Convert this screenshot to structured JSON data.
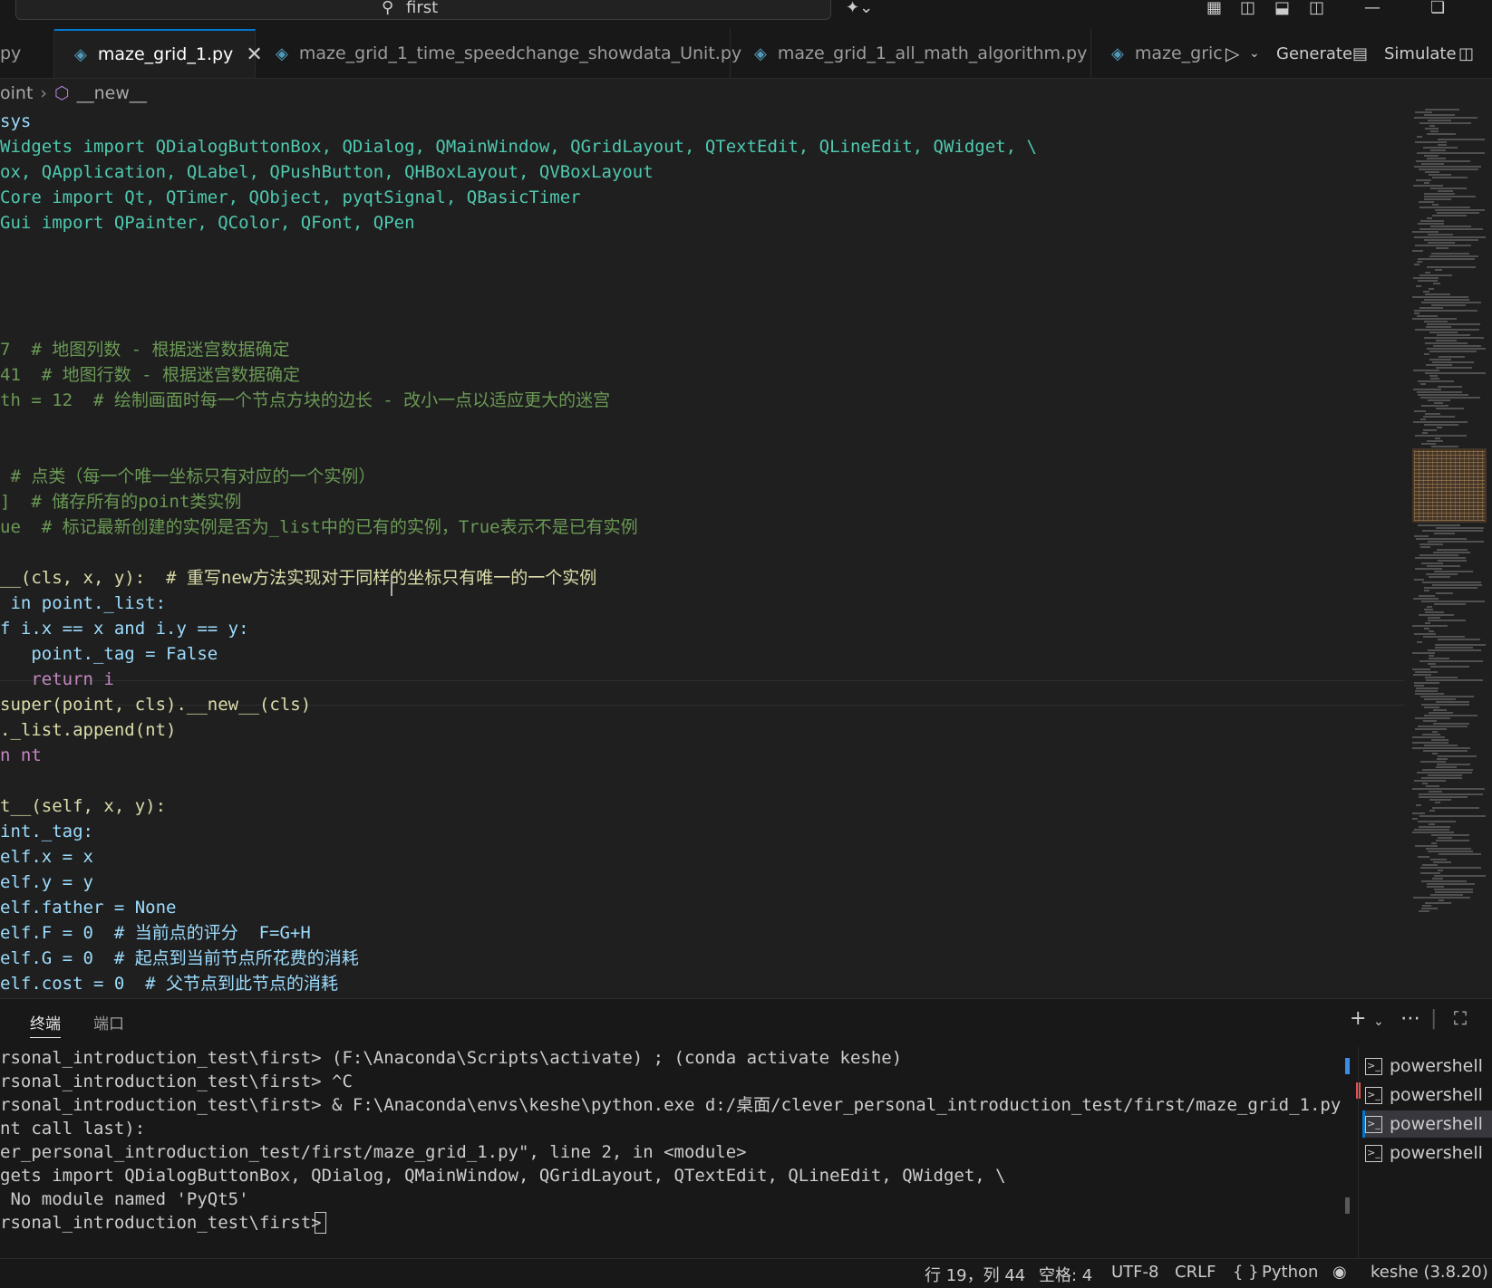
{
  "titlebar": {
    "search_text": "first"
  },
  "tabs": [
    {
      "label": "py",
      "active": false
    },
    {
      "label": "maze_grid_1.py",
      "active": true
    },
    {
      "label": "maze_grid_1_time_speedchange_showdata_Unit.py",
      "active": false
    },
    {
      "label": "maze_grid_1_all_math_algorithm.py",
      "active": false
    },
    {
      "label": "maze_gric",
      "active": false
    }
  ],
  "tab_actions": {
    "generate": "Generate",
    "simulate": "Simulate"
  },
  "breadcrumb": {
    "parent": "oint",
    "symbol": "__new__"
  },
  "editor": {
    "lines": [
      "sys",
      "Widgets import QDialogButtonBox, QDialog, QMainWindow, QGridLayout, QTextEdit, QLineEdit, QWidget, \\",
      "ox, QApplication, QLabel, QPushButton, QHBoxLayout, QVBoxLayout",
      "Core import Qt, QTimer, QObject, pyqtSignal, QBasicTimer",
      "Gui import QPainter, QColor, QFont, QPen",
      "7  # 地图列数 - 根据迷宫数据确定",
      "41  # 地图行数 - 根据迷宫数据确定",
      "th = 12  # 绘制画面时每一个节点方块的边长 - 改小一点以适应更大的迷宫",
      " # 点类（每一个唯一坐标只有对应的一个实例）",
      "]  # 储存所有的point类实例",
      "ue  # 标记最新创建的实例是否为_list中的已有的实例，True表示不是已有实例",
      "__(cls, x, y):  # 重写new方法实现对于同样的坐标只有唯一的一个实例",
      " in point._list:",
      "f i.x == x and i.y == y:",
      "   point._tag = False",
      "   return i",
      "super(point, cls).__new__(cls)",
      "._list.append(nt)",
      "n nt",
      "t__(self, x, y):",
      "int._tag:",
      "elf.x = x",
      "elf.y = y",
      "elf.father = None",
      "elf.F = 0  # 当前点的评分  F=G+H",
      "elf.G = 0  # 起点到当前节点所花费的消耗",
      "elf.cost = 0  # 父节点到此节点的消耗"
    ]
  },
  "panel": {
    "tabs": [
      "终端",
      "端口"
    ],
    "terminal_lines": [
      "rsonal_introduction_test\\first> (F:\\Anaconda\\Scripts\\activate) ; (conda activate keshe)",
      "rsonal_introduction_test\\first> ^C",
      "rsonal_introduction_test\\first> & F:\\Anaconda\\envs\\keshe\\python.exe d:/桌面/clever_personal_introduction_test/first/maze_grid_1.py",
      "nt call last):",
      "er_personal_introduction_test/first/maze_grid_1.py\", line 2, in <module>",
      "gets import QDialogButtonBox, QDialog, QMainWindow, QGridLayout, QTextEdit, QLineEdit, QWidget, \\",
      " No module named 'PyQt5'",
      "rsonal_introduction_test\\first> "
    ],
    "terminals": [
      "powershell",
      "powershell",
      "powershell",
      "powershell"
    ]
  },
  "statusbar": {
    "position": "行 19，列 44",
    "spaces": "空格: 4",
    "encoding": "UTF-8",
    "eol": "CRLF",
    "language": "Python",
    "interpreter": "keshe (3.8.20)"
  },
  "colors": {
    "background": "#1f1f1f",
    "keyword": "#c586c0",
    "builtin": "#569cd6",
    "class": "#4ec9b0",
    "function": "#dcdcaa",
    "variable": "#9cdcfe",
    "number": "#b5cea8",
    "comment": "#6a9955",
    "accent": "#0078d4"
  }
}
